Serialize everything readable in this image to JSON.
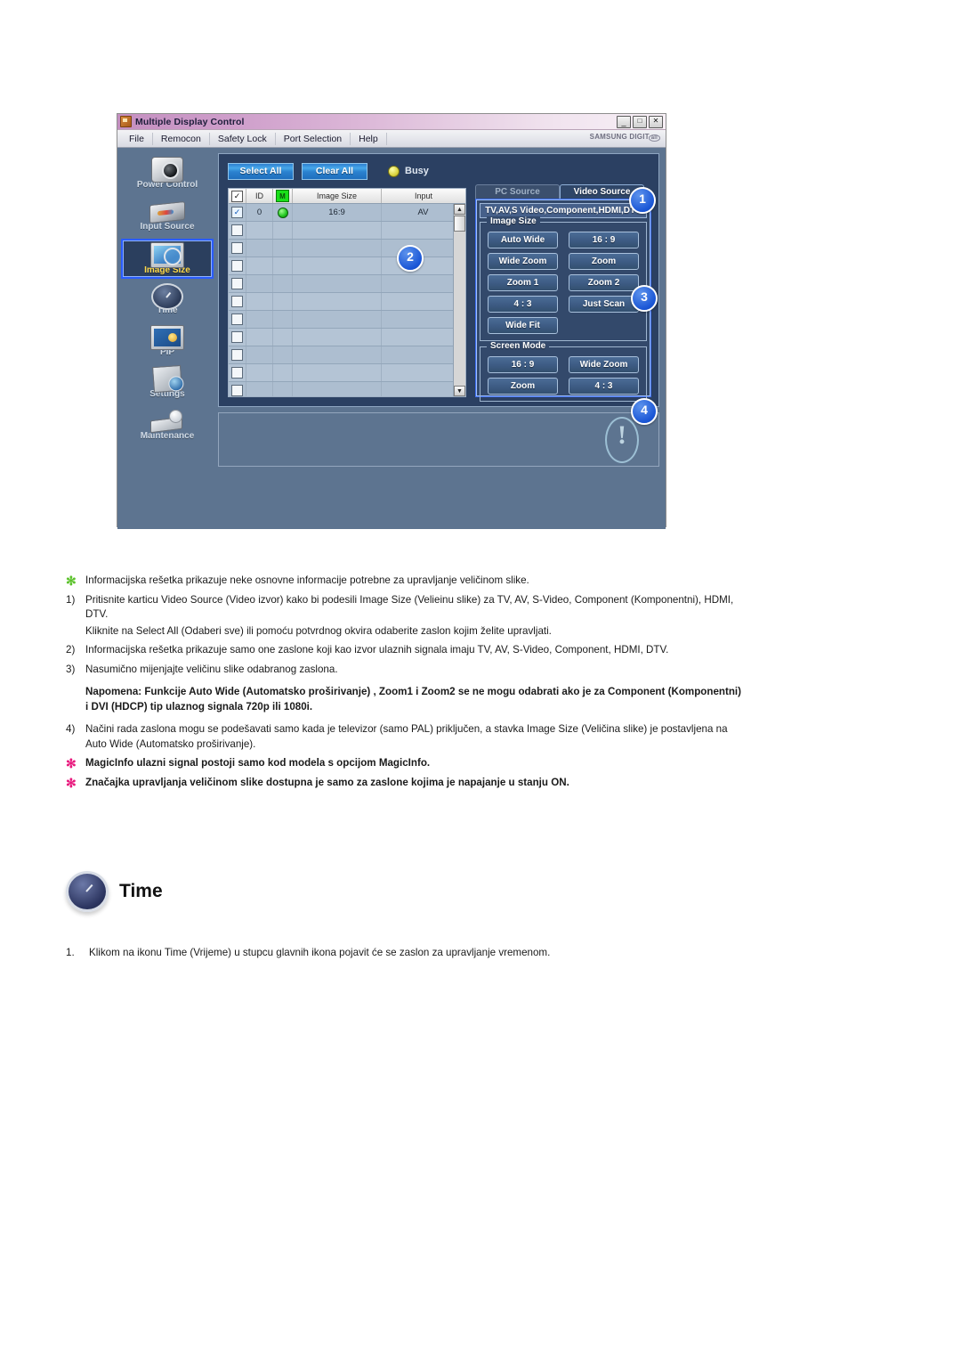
{
  "app": {
    "title": "Multiple Display Control",
    "title_icon": "app-window-icon",
    "window_buttons": [
      {
        "name": "minimize",
        "glyph": "_"
      },
      {
        "name": "maximize",
        "glyph": "□"
      },
      {
        "name": "close",
        "glyph": "✕"
      }
    ],
    "menu": [
      "File",
      "Remocon",
      "Safety Lock",
      "Port Selection",
      "Help"
    ],
    "brand": "SAMSUNG DIGIT",
    "brand_suffix": "all",
    "sidebar": [
      {
        "label": "Power Control",
        "icon": "power-control-icon",
        "selected": false
      },
      {
        "label": "Input Source",
        "icon": "input-source-icon",
        "selected": false
      },
      {
        "label": "Image Size",
        "icon": "image-size-icon",
        "selected": true
      },
      {
        "label": "Time",
        "icon": "time-clock-icon",
        "selected": false
      },
      {
        "label": "PIP",
        "icon": "pip-icon",
        "selected": false
      },
      {
        "label": "Settings",
        "icon": "settings-icon",
        "selected": false
      },
      {
        "label": "Maintenance",
        "icon": "maintenance-icon",
        "selected": false
      }
    ],
    "toolbar": {
      "select_all": "Select All",
      "clear_all": "Clear All",
      "busy_label": "Busy",
      "busy_led_color": "#d8d23a"
    },
    "grid": {
      "columns": [
        "",
        "ID",
        "M",
        "Image Size",
        "Input"
      ],
      "header_checkbox_checked": true,
      "rows": [
        {
          "checked": true,
          "id": "0",
          "power": "on",
          "image_size": "16:9",
          "input": "AV"
        },
        {
          "checked": false,
          "id": "",
          "power": "",
          "image_size": "",
          "input": ""
        },
        {
          "checked": false,
          "id": "",
          "power": "",
          "image_size": "",
          "input": ""
        },
        {
          "checked": false,
          "id": "",
          "power": "",
          "image_size": "",
          "input": ""
        },
        {
          "checked": false,
          "id": "",
          "power": "",
          "image_size": "",
          "input": ""
        },
        {
          "checked": false,
          "id": "",
          "power": "",
          "image_size": "",
          "input": ""
        },
        {
          "checked": false,
          "id": "",
          "power": "",
          "image_size": "",
          "input": ""
        },
        {
          "checked": false,
          "id": "",
          "power": "",
          "image_size": "",
          "input": ""
        },
        {
          "checked": false,
          "id": "",
          "power": "",
          "image_size": "",
          "input": ""
        },
        {
          "checked": false,
          "id": "",
          "power": "",
          "image_size": "",
          "input": ""
        },
        {
          "checked": false,
          "id": "",
          "power": "",
          "image_size": "",
          "input": ""
        },
        {
          "checked": false,
          "id": "",
          "power": "",
          "image_size": "",
          "input": ""
        }
      ]
    },
    "source_panel": {
      "tabs": [
        {
          "label": "PC Source",
          "active": false
        },
        {
          "label": "Video Source",
          "active": true
        }
      ],
      "source_title": "TV,AV,S Video,Component,HDMI,DTV",
      "image_size_group": {
        "label": "Image Size",
        "buttons": [
          "Auto Wide",
          "16 : 9",
          "Wide Zoom",
          "Zoom",
          "Zoom 1",
          "Zoom 2",
          "4 : 3",
          "Just Scan",
          "Wide Fit"
        ]
      },
      "screen_mode_group": {
        "label": "Screen Mode",
        "buttons": [
          "16 : 9",
          "Wide Zoom",
          "Zoom",
          "4 : 3"
        ]
      }
    },
    "status_panel": {
      "message": "",
      "icon": "exclamation-icon"
    },
    "callouts": [
      "1",
      "2",
      "3",
      "4"
    ],
    "accent_color": "#1a56d6"
  },
  "doc": {
    "notes": [
      {
        "marker": "✻",
        "marker_style": "star-green",
        "bold": false,
        "text": "Informacijska rešetka prikazuje neke osnovne informacije potrebne za upravljanje veličinom slike."
      },
      {
        "marker": "1)",
        "marker_style": "num",
        "bold": false,
        "text": "Pritisnite karticu Video Source (Video izvor) kako bi podesili Image Size (Velieinu slike) za TV, AV, S-Video, Component (Komponentni), HDMI, DTV."
      },
      {
        "marker": "",
        "marker_style": "num",
        "bold": false,
        "text": "Kliknite na Select All (Odaberi sve) ili pomoću potvrdnog okvira odaberite zaslon kojim želite upravljati."
      },
      {
        "marker": "2)",
        "marker_style": "num",
        "bold": false,
        "text": "Informacijska rešetka prikazuje samo one zaslone koji kao izvor ulaznih signala imaju TV, AV, S-Video, Component, HDMI, DTV."
      },
      {
        "marker": "3)",
        "marker_style": "num",
        "bold": false,
        "text": "Nasumično mijenjajte veličinu slike odabranog zaslona."
      },
      {
        "marker": "",
        "marker_style": "num",
        "bold": true,
        "text": "Napomena: Funkcije Auto Wide (Automatsko proširivanje) , Zoom1 i Zoom2 se ne mogu odabrati ako je za Component (Komponentni) i DVI (HDCP) tip ulaznog signala 720p ili 1080i."
      },
      {
        "marker": "4)",
        "marker_style": "num",
        "bold": false,
        "text": "Načini rada zaslona mogu se podešavati samo kada je televizor (samo PAL) priključen, a stavka Image Size (Veličina slike) je postavljena na Auto Wide (Automatsko proširivanje)."
      },
      {
        "marker": "✻",
        "marker_style": "star-pink",
        "bold": true,
        "text": "MagicInfo ulazni signal postoji samo kod modela s opcijom MagicInfo."
      },
      {
        "marker": "✻",
        "marker_style": "star-pink",
        "bold": true,
        "text": "Značajka upravljanja veličinom slike dostupna je samo za zaslone kojima je napajanje u stanju ON."
      }
    ]
  },
  "time_section": {
    "icon": "time-clock-icon",
    "title": "Time",
    "step_marker": "1.",
    "step_text": "Klikom na ikonu Time (Vrijeme) u stupcu glavnih ikona pojavit će se zaslon za upravljanje vremenom."
  }
}
